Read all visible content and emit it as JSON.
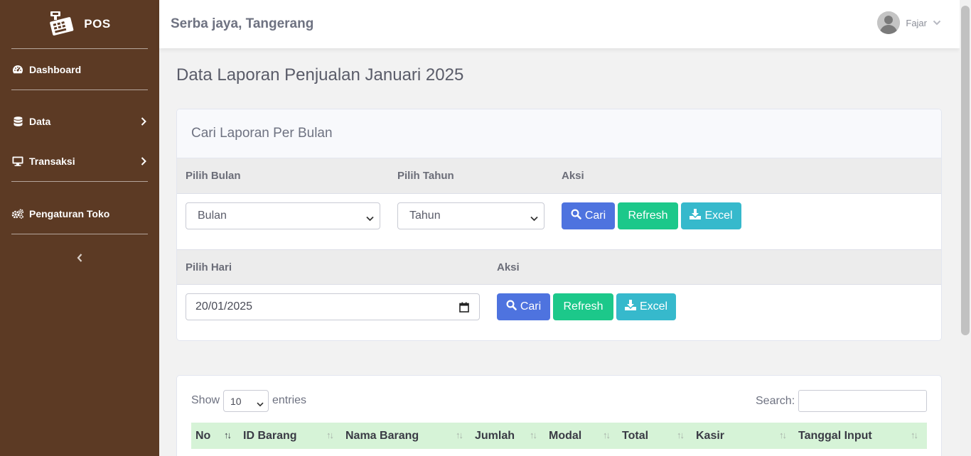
{
  "sidebar": {
    "brand": "POS",
    "items": [
      {
        "label": "Dashboard",
        "icon": "tachometer-icon"
      },
      {
        "label": "Data",
        "icon": "database-icon",
        "has_submenu": true
      },
      {
        "label": "Transaksi",
        "icon": "desktop-icon",
        "has_submenu": true
      },
      {
        "label": "Pengaturan Toko",
        "icon": "cogs-icon"
      }
    ]
  },
  "topbar": {
    "store_name": "Serba jaya, Tangerang",
    "user_name": "Fajar"
  },
  "page": {
    "title": "Data Laporan Penjualan Januari 2025"
  },
  "monthly": {
    "card_title": "Cari Laporan Per Bulan",
    "month_header": "Pilih Bulan",
    "year_header": "Pilih Tahun",
    "action_header": "Aksi",
    "month_value": "Bulan",
    "year_value": "Tahun",
    "search_label": "Cari",
    "refresh_label": "Refresh",
    "excel_label": "Excel"
  },
  "daily": {
    "day_header": "Pilih Hari",
    "action_header": "Aksi",
    "date_value": "20/01/2025",
    "search_label": "Cari",
    "refresh_label": "Refresh",
    "excel_label": "Excel"
  },
  "table": {
    "show_label": "Show",
    "length_value": "10",
    "entries_label": "entries",
    "search_label": "Search:",
    "columns": [
      "No",
      "ID Barang",
      "Nama Barang",
      "Jumlah",
      "Modal",
      "Total",
      "Kasir",
      "Tanggal Input"
    ]
  },
  "colors": {
    "sidebar": "#5c3a24",
    "primary": "#4e73df",
    "success": "#1cc88a",
    "info": "#36b9cc",
    "table_header": "#d6f3d7"
  }
}
